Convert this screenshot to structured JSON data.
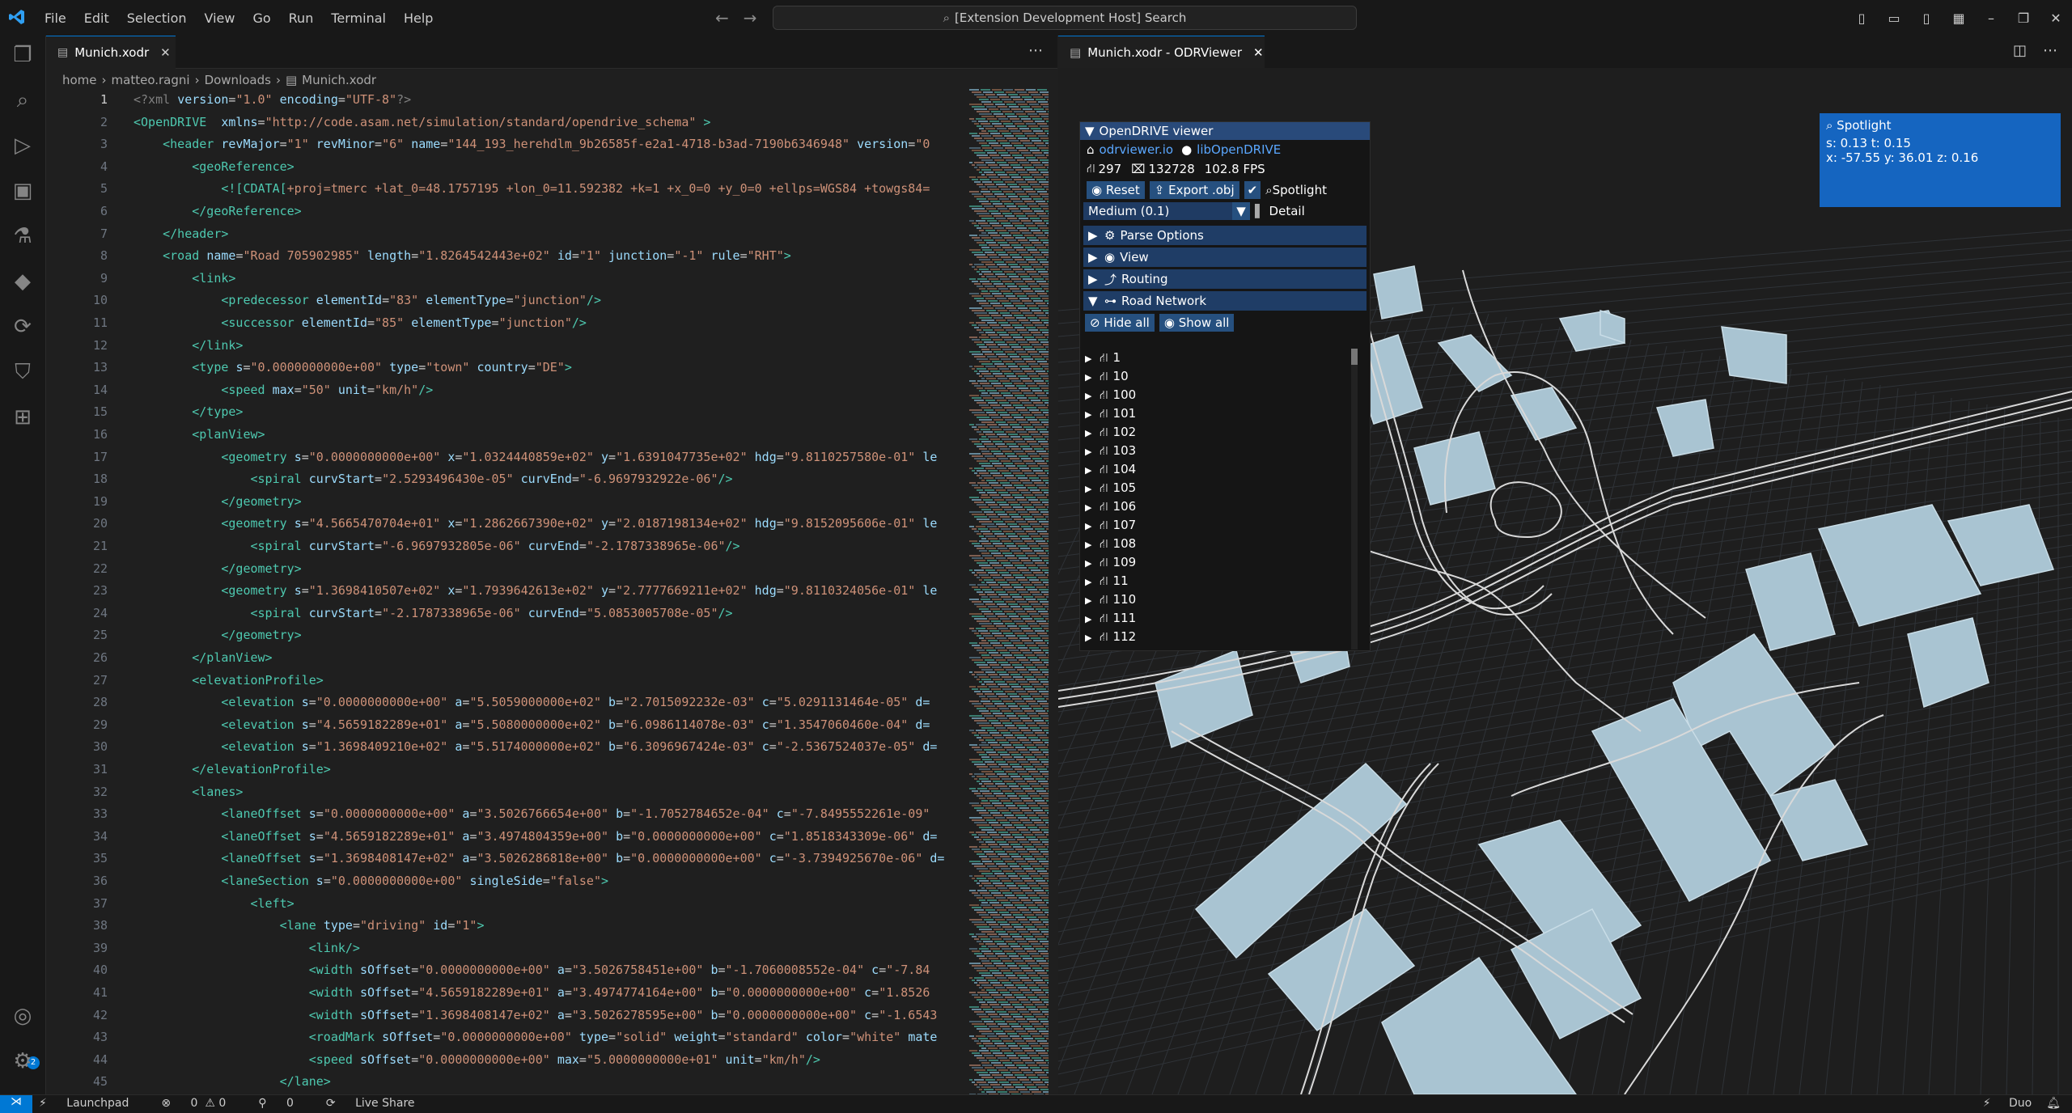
{
  "menu": [
    "File",
    "Edit",
    "Selection",
    "View",
    "Go",
    "Run",
    "Terminal",
    "Help"
  ],
  "search": {
    "text": "[Extension Development Host] Search"
  },
  "editor": {
    "tab_label": "Munich.xodr",
    "breadcrumb": [
      "home",
      "matteo.ragni",
      "Downloads",
      "Munich.xodr"
    ],
    "lines": [
      {
        "n": "1",
        "html": "<span class=\"pn\">&lt;?xml</span> <span class=\"at\">version</span>=<span class=\"vl\">\"1.0\"</span> <span class=\"at\">encoding</span>=<span class=\"vl\">\"UTF-8\"</span><span class=\"pn\">?&gt;</span>"
      },
      {
        "n": "2",
        "html": "<span class=\"tg\">&lt;OpenDRIVE</span>  <span class=\"at\">xmlns</span>=<span class=\"vl\">\"http://code.asam.net/simulation/standard/opendrive_schema\"</span> <span class=\"tg\">&gt;</span>"
      },
      {
        "n": "3",
        "html": "    <span class=\"tg\">&lt;header</span> <span class=\"at\">revMajor</span>=<span class=\"vl\">\"1\"</span> <span class=\"at\">revMinor</span>=<span class=\"vl\">\"6\"</span> <span class=\"at\">name</span>=<span class=\"vl\">\"144_193_herehdlm_9b26585f-e2a1-4718-b3ad-7190b6346948\"</span> <span class=\"at\">version</span>=<span class=\"vl\">\"0</span>"
      },
      {
        "n": "4",
        "html": "        <span class=\"tg\">&lt;geoReference&gt;</span>"
      },
      {
        "n": "5",
        "html": "            <span class=\"tg\">&lt;![CDATA[</span><span class=\"vl\">+proj=tmerc +lat_0=48.1757195 +lon_0=11.592382 +k=1 +x_0=0 +y_0=0 +ellps=WGS84 +towgs84=</span>"
      },
      {
        "n": "6",
        "html": "        <span class=\"tg\">&lt;/geoReference&gt;</span>"
      },
      {
        "n": "7",
        "html": "    <span class=\"tg\">&lt;/header&gt;</span>"
      },
      {
        "n": "8",
        "html": "    <span class=\"tg\">&lt;road</span> <span class=\"at\">name</span>=<span class=\"vl\">\"Road 705902985\"</span> <span class=\"at\">length</span>=<span class=\"vl\">\"1.8264542443e+02\"</span> <span class=\"at\">id</span>=<span class=\"vl\">\"1\"</span> <span class=\"at\">junction</span>=<span class=\"vl\">\"-1\"</span> <span class=\"at\">rule</span>=<span class=\"vl\">\"RHT\"</span><span class=\"tg\">&gt;</span>"
      },
      {
        "n": "9",
        "html": "        <span class=\"tg\">&lt;link&gt;</span>"
      },
      {
        "n": "10",
        "html": "            <span class=\"tg\">&lt;predecessor</span> <span class=\"at\">elementId</span>=<span class=\"vl\">\"83\"</span> <span class=\"at\">elementType</span>=<span class=\"vl\">\"junction\"</span><span class=\"tg\">/&gt;</span>"
      },
      {
        "n": "11",
        "html": "            <span class=\"tg\">&lt;successor</span> <span class=\"at\">elementId</span>=<span class=\"vl\">\"85\"</span> <span class=\"at\">elementType</span>=<span class=\"vl\">\"junction\"</span><span class=\"tg\">/&gt;</span>"
      },
      {
        "n": "12",
        "html": "        <span class=\"tg\">&lt;/link&gt;</span>"
      },
      {
        "n": "13",
        "html": "        <span class=\"tg\">&lt;type</span> <span class=\"at\">s</span>=<span class=\"vl\">\"0.0000000000e+00\"</span> <span class=\"at\">type</span>=<span class=\"vl\">\"town\"</span> <span class=\"at\">country</span>=<span class=\"vl\">\"DE\"</span><span class=\"tg\">&gt;</span>"
      },
      {
        "n": "14",
        "html": "            <span class=\"tg\">&lt;speed</span> <span class=\"at\">max</span>=<span class=\"vl\">\"50\"</span> <span class=\"at\">unit</span>=<span class=\"vl\">\"km/h\"</span><span class=\"tg\">/&gt;</span>"
      },
      {
        "n": "15",
        "html": "        <span class=\"tg\">&lt;/type&gt;</span>"
      },
      {
        "n": "16",
        "html": "        <span class=\"tg\">&lt;planView&gt;</span>"
      },
      {
        "n": "17",
        "html": "            <span class=\"tg\">&lt;geometry</span> <span class=\"at\">s</span>=<span class=\"vl\">\"0.0000000000e+00\"</span> <span class=\"at\">x</span>=<span class=\"vl\">\"1.0324440859e+02\"</span> <span class=\"at\">y</span>=<span class=\"vl\">\"1.6391047735e+02\"</span> <span class=\"at\">hdg</span>=<span class=\"vl\">\"9.8110257580e-01\"</span> <span class=\"at\">le</span>"
      },
      {
        "n": "18",
        "html": "                <span class=\"tg\">&lt;spiral</span> <span class=\"at\">curvStart</span>=<span class=\"vl\">\"2.5293496430e-05\"</span> <span class=\"at\">curvEnd</span>=<span class=\"vl\">\"-6.9697932922e-06\"</span><span class=\"tg\">/&gt;</span>"
      },
      {
        "n": "19",
        "html": "            <span class=\"tg\">&lt;/geometry&gt;</span>"
      },
      {
        "n": "20",
        "html": "            <span class=\"tg\">&lt;geometry</span> <span class=\"at\">s</span>=<span class=\"vl\">\"4.5665470704e+01\"</span> <span class=\"at\">x</span>=<span class=\"vl\">\"1.2862667390e+02\"</span> <span class=\"at\">y</span>=<span class=\"vl\">\"2.0187198134e+02\"</span> <span class=\"at\">hdg</span>=<span class=\"vl\">\"9.8152095606e-01\"</span> <span class=\"at\">le</span>"
      },
      {
        "n": "21",
        "html": "                <span class=\"tg\">&lt;spiral</span> <span class=\"at\">curvStart</span>=<span class=\"vl\">\"-6.9697932805e-06\"</span> <span class=\"at\">curvEnd</span>=<span class=\"vl\">\"-2.1787338965e-06\"</span><span class=\"tg\">/&gt;</span>"
      },
      {
        "n": "22",
        "html": "            <span class=\"tg\">&lt;/geometry&gt;</span>"
      },
      {
        "n": "23",
        "html": "            <span class=\"tg\">&lt;geometry</span> <span class=\"at\">s</span>=<span class=\"vl\">\"1.3698410507e+02\"</span> <span class=\"at\">x</span>=<span class=\"vl\">\"1.7939642613e+02\"</span> <span class=\"at\">y</span>=<span class=\"vl\">\"2.7777669211e+02\"</span> <span class=\"at\">hdg</span>=<span class=\"vl\">\"9.8110324056e-01\"</span> <span class=\"at\">le</span>"
      },
      {
        "n": "24",
        "html": "                <span class=\"tg\">&lt;spiral</span> <span class=\"at\">curvStart</span>=<span class=\"vl\">\"-2.1787338965e-06\"</span> <span class=\"at\">curvEnd</span>=<span class=\"vl\">\"5.0853005708e-05\"</span><span class=\"tg\">/&gt;</span>"
      },
      {
        "n": "25",
        "html": "            <span class=\"tg\">&lt;/geometry&gt;</span>"
      },
      {
        "n": "26",
        "html": "        <span class=\"tg\">&lt;/planView&gt;</span>"
      },
      {
        "n": "27",
        "html": "        <span class=\"tg\">&lt;elevationProfile&gt;</span>"
      },
      {
        "n": "28",
        "html": "            <span class=\"tg\">&lt;elevation</span> <span class=\"at\">s</span>=<span class=\"vl\">\"0.0000000000e+00\"</span> <span class=\"at\">a</span>=<span class=\"vl\">\"5.5059000000e+02\"</span> <span class=\"at\">b</span>=<span class=\"vl\">\"2.7015092232e-03\"</span> <span class=\"at\">c</span>=<span class=\"vl\">\"5.0291131464e-05\"</span> <span class=\"at\">d=</span>"
      },
      {
        "n": "29",
        "html": "            <span class=\"tg\">&lt;elevation</span> <span class=\"at\">s</span>=<span class=\"vl\">\"4.5659182289e+01\"</span> <span class=\"at\">a</span>=<span class=\"vl\">\"5.5080000000e+02\"</span> <span class=\"at\">b</span>=<span class=\"vl\">\"6.0986114078e-03\"</span> <span class=\"at\">c</span>=<span class=\"vl\">\"1.3547060460e-04\"</span> <span class=\"at\">d=</span>"
      },
      {
        "n": "30",
        "html": "            <span class=\"tg\">&lt;elevation</span> <span class=\"at\">s</span>=<span class=\"vl\">\"1.3698409210e+02\"</span> <span class=\"at\">a</span>=<span class=\"vl\">\"5.5174000000e+02\"</span> <span class=\"at\">b</span>=<span class=\"vl\">\"6.3096967424e-03\"</span> <span class=\"at\">c</span>=<span class=\"vl\">\"-2.5367524037e-05\"</span> <span class=\"at\">d=</span>"
      },
      {
        "n": "31",
        "html": "        <span class=\"tg\">&lt;/elevationProfile&gt;</span>"
      },
      {
        "n": "32",
        "html": "        <span class=\"tg\">&lt;lanes&gt;</span>"
      },
      {
        "n": "33",
        "html": "            <span class=\"tg\">&lt;laneOffset</span> <span class=\"at\">s</span>=<span class=\"vl\">\"0.0000000000e+00\"</span> <span class=\"at\">a</span>=<span class=\"vl\">\"3.5026766654e+00\"</span> <span class=\"at\">b</span>=<span class=\"vl\">\"-1.7052784652e-04\"</span> <span class=\"at\">c</span>=<span class=\"vl\">\"-7.8495552261e-09\"</span>"
      },
      {
        "n": "34",
        "html": "            <span class=\"tg\">&lt;laneOffset</span> <span class=\"at\">s</span>=<span class=\"vl\">\"4.5659182289e+01\"</span> <span class=\"at\">a</span>=<span class=\"vl\">\"3.4974804359e+00\"</span> <span class=\"at\">b</span>=<span class=\"vl\">\"0.0000000000e+00\"</span> <span class=\"at\">c</span>=<span class=\"vl\">\"1.8518343309e-06\"</span> <span class=\"at\">d=</span>"
      },
      {
        "n": "35",
        "html": "            <span class=\"tg\">&lt;laneOffset</span> <span class=\"at\">s</span>=<span class=\"vl\">\"1.3698408147e+02\"</span> <span class=\"at\">a</span>=<span class=\"vl\">\"3.5026286818e+00\"</span> <span class=\"at\">b</span>=<span class=\"vl\">\"0.0000000000e+00\"</span> <span class=\"at\">c</span>=<span class=\"vl\">\"-3.7394925670e-06\"</span> <span class=\"at\">d=</span>"
      },
      {
        "n": "36",
        "html": "            <span class=\"tg\">&lt;laneSection</span> <span class=\"at\">s</span>=<span class=\"vl\">\"0.0000000000e+00\"</span> <span class=\"at\">singleSide</span>=<span class=\"vl\">\"false\"</span><span class=\"tg\">&gt;</span>"
      },
      {
        "n": "37",
        "html": "                <span class=\"tg\">&lt;left&gt;</span>"
      },
      {
        "n": "38",
        "html": "                    <span class=\"tg\">&lt;lane</span> <span class=\"at\">type</span>=<span class=\"vl\">\"driving\"</span> <span class=\"at\">id</span>=<span class=\"vl\">\"1\"</span><span class=\"tg\">&gt;</span>"
      },
      {
        "n": "39",
        "html": "                        <span class=\"tg\">&lt;link/&gt;</span>"
      },
      {
        "n": "40",
        "html": "                        <span class=\"tg\">&lt;width</span> <span class=\"at\">sOffset</span>=<span class=\"vl\">\"0.0000000000e+00\"</span> <span class=\"at\">a</span>=<span class=\"vl\">\"3.5026758451e+00\"</span> <span class=\"at\">b</span>=<span class=\"vl\">\"-1.7060008552e-04\"</span> <span class=\"at\">c</span>=<span class=\"vl\">\"-7.84</span>"
      },
      {
        "n": "41",
        "html": "                        <span class=\"tg\">&lt;width</span> <span class=\"at\">sOffset</span>=<span class=\"vl\">\"4.5659182289e+01\"</span> <span class=\"at\">a</span>=<span class=\"vl\">\"3.4974774164e+00\"</span> <span class=\"at\">b</span>=<span class=\"vl\">\"0.0000000000e+00\"</span> <span class=\"at\">c</span>=<span class=\"vl\">\"1.8526</span>"
      },
      {
        "n": "42",
        "html": "                        <span class=\"tg\">&lt;width</span> <span class=\"at\">sOffset</span>=<span class=\"vl\">\"1.3698408147e+02\"</span> <span class=\"at\">a</span>=<span class=\"vl\">\"3.5026278595e+00\"</span> <span class=\"at\">b</span>=<span class=\"vl\">\"0.0000000000e+00\"</span> <span class=\"at\">c</span>=<span class=\"vl\">\"-1.6543</span>"
      },
      {
        "n": "43",
        "html": "                        <span class=\"tg\">&lt;roadMark</span> <span class=\"at\">sOffset</span>=<span class=\"vl\">\"0.0000000000e+00\"</span> <span class=\"at\">type</span>=<span class=\"vl\">\"solid\"</span> <span class=\"at\">weight</span>=<span class=\"vl\">\"standard\"</span> <span class=\"at\">color</span>=<span class=\"vl\">\"white\"</span> <span class=\"at\">mate</span>"
      },
      {
        "n": "44",
        "html": "                        <span class=\"tg\">&lt;speed</span> <span class=\"at\">sOffset</span>=<span class=\"vl\">\"0.0000000000e+00\"</span> <span class=\"at\">max</span>=<span class=\"vl\">\"5.0000000000e+01\"</span> <span class=\"at\">unit</span>=<span class=\"vl\">\"km/h\"</span><span class=\"tg\">/&gt;</span>"
      },
      {
        "n": "45",
        "html": "                    <span class=\"tg\">&lt;/lane&gt;</span>"
      }
    ]
  },
  "viewer": {
    "tab_label": "Munich.xodr - ODRViewer",
    "panel_title": "OpenDRIVE viewer",
    "link1": "odrviewer.io",
    "link2": "libOpenDRIVE",
    "stat_roads": "297",
    "stat_lanes": "132728",
    "fps": "102.8 FPS",
    "btn_reset": "Reset",
    "btn_export": "Export .obj",
    "spotlight_label": "Spotlight",
    "quality": "Medium (0.1)",
    "detail": "Detail",
    "sections": [
      "Parse Options",
      "View",
      "Routing",
      "Road Network"
    ],
    "hide_all": "Hide all",
    "show_all": "Show all",
    "roads": [
      "1",
      "10",
      "100",
      "101",
      "102",
      "103",
      "104",
      "105",
      "106",
      "107",
      "108",
      "109",
      "11",
      "110",
      "111",
      "112"
    ]
  },
  "spotlight": {
    "title": "Spotlight",
    "line1": "s: 0.13  t: 0.15",
    "line2": "x: -57.55  y: 36.01  z: 0.16"
  },
  "status": {
    "launchpad": "Launchpad",
    "problems": "0  ⚠ 0",
    "ports": "0",
    "liveshare": "Live Share",
    "duo": "Duo"
  },
  "colors": {
    "accent": "#0078d4",
    "panel_header": "#294a7a",
    "spotlight": "#1565c0",
    "building": "#a9c4d2"
  }
}
